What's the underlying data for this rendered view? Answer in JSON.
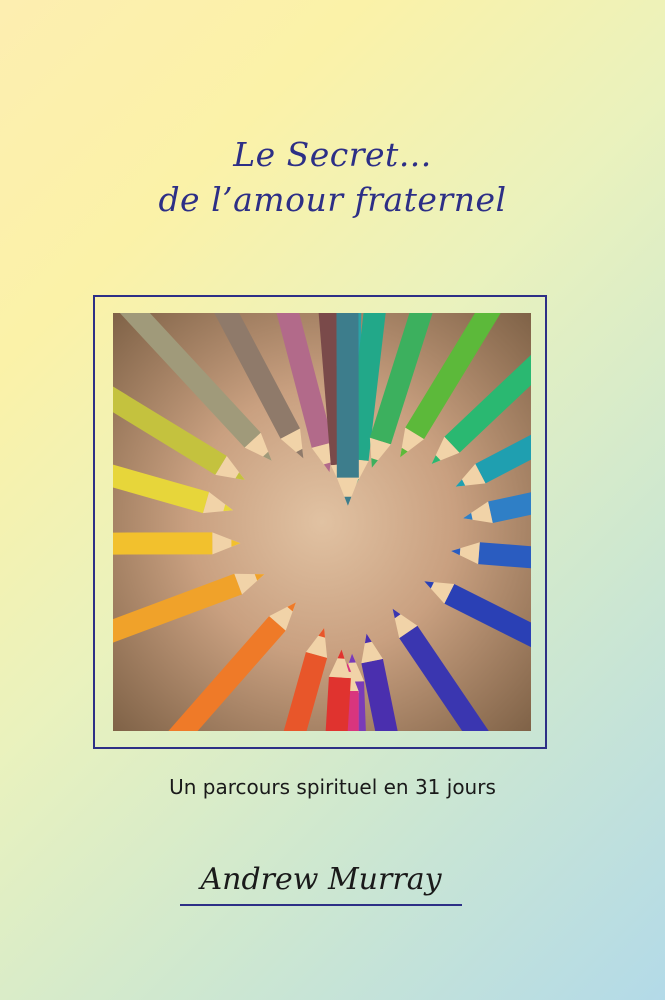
{
  "cover": {
    "title_line1": "Le Secret...",
    "title_line2": "de l’amour fraternel",
    "subtitle": "Un parcours spirituel en 31 jours",
    "author": "Andrew Murray"
  },
  "colors": {
    "title": "#2d2f86",
    "frame": "#2d2f86",
    "text": "#1a1a1a"
  },
  "image": {
    "subject": "colored pencils arranged in a heart shape",
    "pencil_colors": [
      "#2aa3a6",
      "#22a889",
      "#3cb05e",
      "#5cb93a",
      "#2ab871",
      "#1f9fb0",
      "#2f7fc6",
      "#2a5cc0",
      "#2a40b5",
      "#3a36b0",
      "#4a2fae",
      "#7a3bb8",
      "#b43fa8",
      "#d9357e",
      "#e0332f",
      "#e8562a",
      "#ef7a28",
      "#f0a22a",
      "#f2c12d",
      "#e7d63a",
      "#c4c23e",
      "#a09a7a",
      "#8f7a6a",
      "#b26a8a",
      "#7a4a4a",
      "#3d7d8c"
    ]
  }
}
